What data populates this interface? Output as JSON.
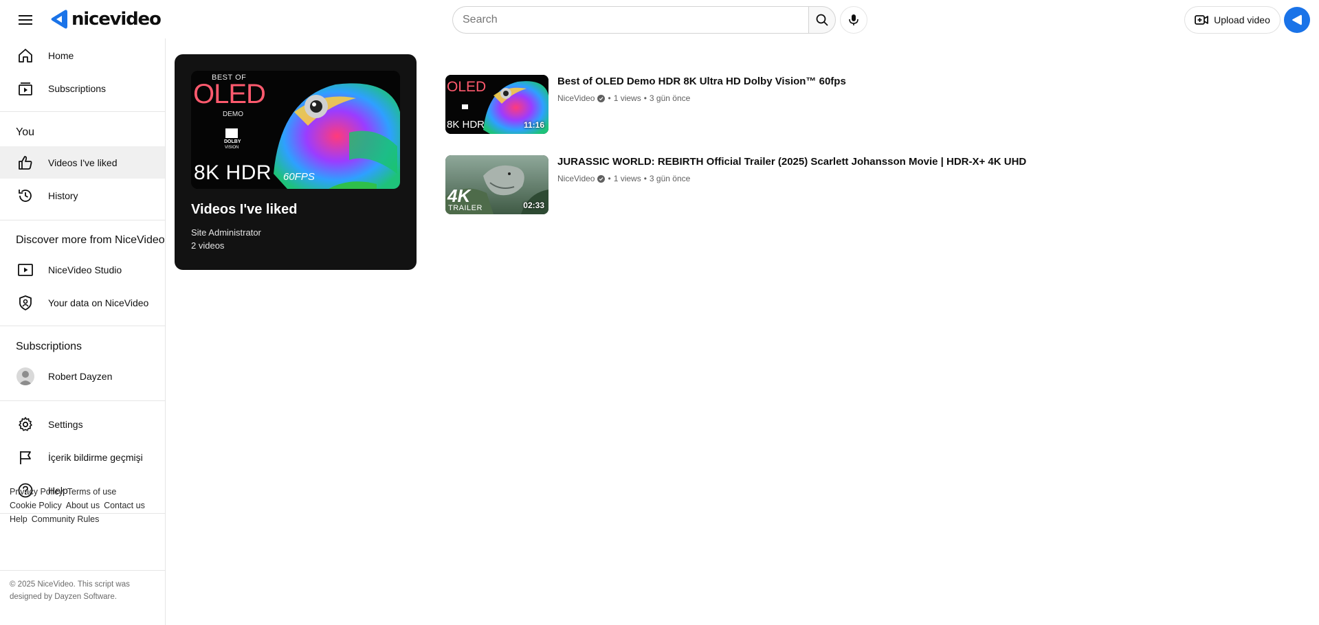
{
  "app": {
    "logo_text": "nicevideo",
    "brand_color": "#1a73e8"
  },
  "header": {
    "search_placeholder": "Search",
    "upload_label": "Upload video"
  },
  "sidebar": {
    "main": [
      {
        "label": "Home",
        "icon": "home-icon"
      },
      {
        "label": "Subscriptions",
        "icon": "subscriptions-icon"
      }
    ],
    "you_title": "You",
    "you_items": [
      {
        "label": "Videos I've liked",
        "icon": "thumbs-up-icon",
        "active": true
      },
      {
        "label": "History",
        "icon": "history-icon"
      }
    ],
    "discover_title": "Discover more from NiceVideo",
    "discover_items": [
      {
        "label": "NiceVideo Studio",
        "icon": "studio-icon"
      },
      {
        "label": "Your data on NiceVideo",
        "icon": "shield-user-icon"
      }
    ],
    "subscriptions_title": "Subscriptions",
    "subscriptions_items": [
      {
        "label": "Robert Dayzen",
        "icon": "avatar-icon"
      }
    ],
    "settings_items": [
      {
        "label": "Settings",
        "icon": "gear-icon"
      },
      {
        "label": "İçerik bildirme geçmişi",
        "icon": "flag-icon"
      },
      {
        "label": "Help",
        "icon": "help-icon"
      }
    ],
    "footer_links": [
      "Privacy Policy",
      "Terms of use",
      "Cookie Policy",
      "About us",
      "Contact us",
      "Help",
      "Community Rules"
    ],
    "copyright": "© 2025 NiceVideo. This script was designed by Dayzen Software."
  },
  "playlist": {
    "title": "Videos I've liked",
    "owner": "Site Administrator",
    "count": "2 videos",
    "thumb": {
      "line1": "BEST OF",
      "line2": "OLED",
      "line3": "DEMO",
      "dolby": "DOLBY",
      "vision": "VISION",
      "big": "8K HDR",
      "fps": "60FPS"
    }
  },
  "videos": [
    {
      "title": "Best of OLED Demo HDR 8K Ultra HD Dolby Vision™ 60fps",
      "channel": "NiceVideo",
      "views": "1 views",
      "age": "3 gün önce",
      "duration": "11:16",
      "thumb_text": "OLED",
      "thumb_text_small": "8K HDR"
    },
    {
      "title": "JURASSIC WORLD: REBIRTH Official Trailer (2025) Scarlett Johansson Movie | HDR-X+ 4K UHD",
      "channel": "NiceVideo",
      "views": "1 views",
      "age": "3 gün önce",
      "duration": "02:33",
      "thumb_text": "4K",
      "thumb_text_small": "TRAILER"
    }
  ]
}
